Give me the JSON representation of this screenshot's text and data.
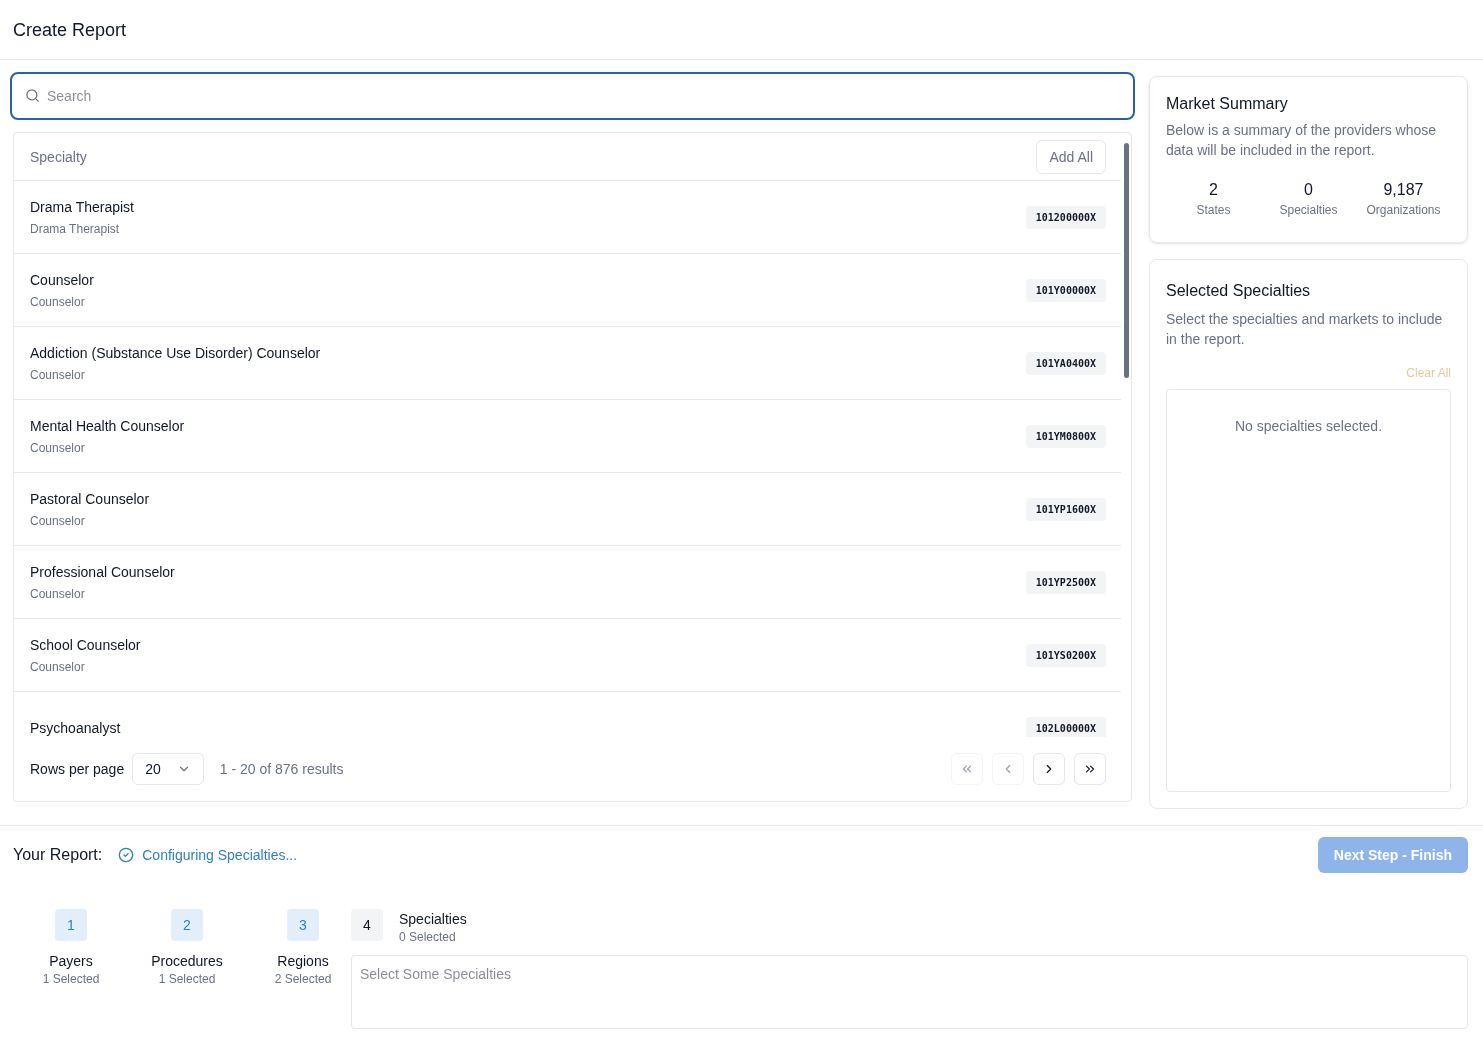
{
  "title": "Create Report",
  "search": {
    "placeholder": "Search"
  },
  "table": {
    "column": "Specialty",
    "add_all": "Add All",
    "rows": [
      {
        "name": "Drama Therapist",
        "category": "Drama Therapist",
        "code": "101200000X"
      },
      {
        "name": "Counselor",
        "category": "Counselor",
        "code": "101Y00000X"
      },
      {
        "name": "Addiction (Substance Use Disorder) Counselor",
        "category": "Counselor",
        "code": "101YA0400X"
      },
      {
        "name": "Mental Health Counselor",
        "category": "Counselor",
        "code": "101YM0800X"
      },
      {
        "name": "Pastoral Counselor",
        "category": "Counselor",
        "code": "101YP1600X"
      },
      {
        "name": "Professional Counselor",
        "category": "Counselor",
        "code": "101YP2500X"
      },
      {
        "name": "School Counselor",
        "category": "Counselor",
        "code": "101YS0200X"
      },
      {
        "name": "Psychoanalyst",
        "code": "102L00000X"
      }
    ],
    "rows_per_page_label": "Rows per page",
    "rows_per_page": "20",
    "range": "1 - 20 of 876 results",
    "pager": [
      {
        "kind": "first",
        "disabled": true
      },
      {
        "kind": "prev",
        "disabled": true
      },
      {
        "kind": "next",
        "disabled": false
      },
      {
        "kind": "last",
        "disabled": false
      }
    ]
  },
  "market_summary": {
    "title": "Market Summary",
    "description": "Below is a summary of the providers whose data will be included in the report.",
    "stats": [
      {
        "value": "2",
        "label": "States"
      },
      {
        "value": "0",
        "label": "Specialties"
      },
      {
        "value": "9,187",
        "label": "Organizations"
      }
    ]
  },
  "selected_specialties": {
    "title": "Selected Specialties",
    "description": "Select the specialties and markets to include in the report.",
    "clear_all": "Clear All",
    "empty": "No specialties selected."
  },
  "report": {
    "label": "Your Report:",
    "status": "Configuring Specialties...",
    "next": {
      "label": "Next Step - Finish",
      "disabled": true
    },
    "steps": [
      {
        "number": "1",
        "name": "Payers",
        "count": "1 Selected",
        "completed": true
      },
      {
        "number": "2",
        "name": "Procedures",
        "count": "1 Selected",
        "completed": true
      },
      {
        "number": "3",
        "name": "Regions",
        "count": "2 Selected",
        "completed": true
      },
      {
        "number": "4",
        "name": "Specialties",
        "count": "0 Selected",
        "completed": false,
        "placeholder": "Select Some Specialties"
      }
    ]
  }
}
